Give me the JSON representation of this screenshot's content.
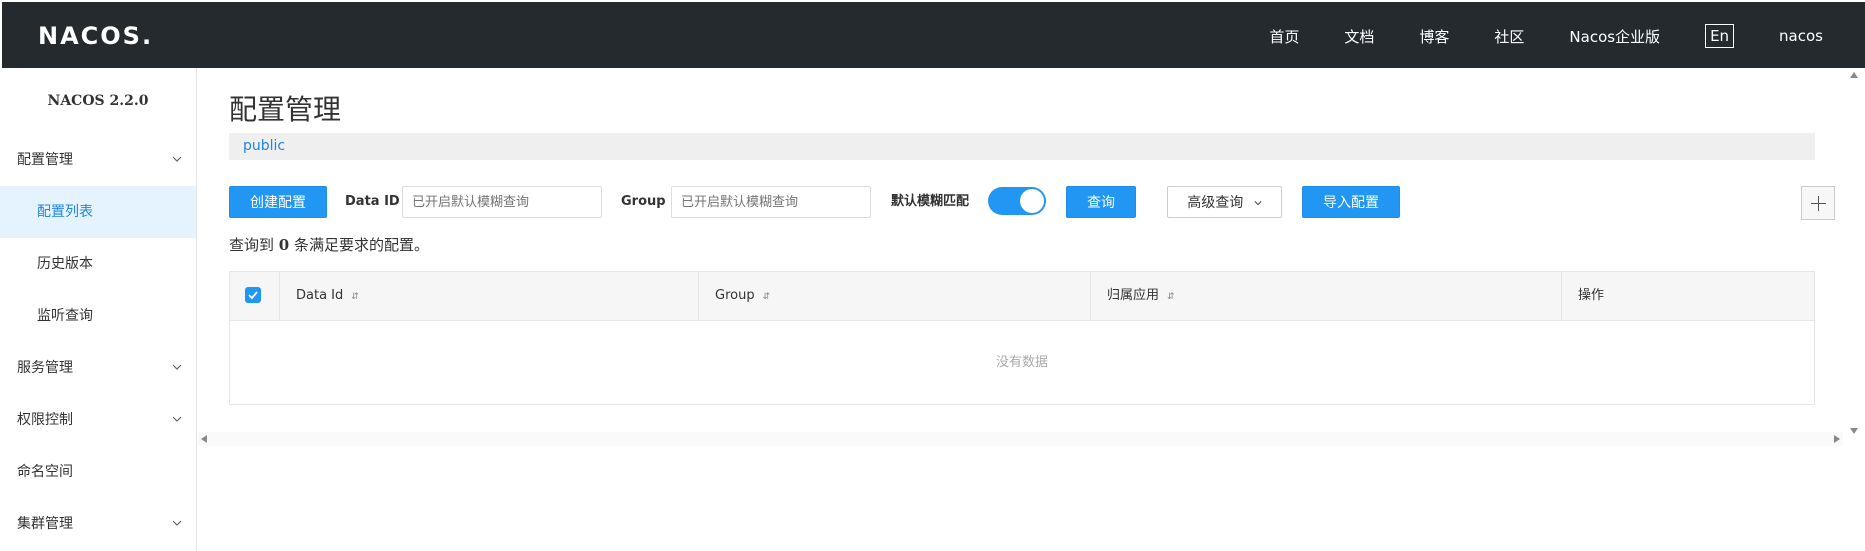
{
  "header": {
    "logo": "NACOS",
    "logo_dot": ".",
    "nav": [
      "首页",
      "文档",
      "博客",
      "社区",
      "Nacos企业版"
    ],
    "lang": "En",
    "user": "nacos"
  },
  "sidebar": {
    "version": "NACOS 2.2.0",
    "items": [
      {
        "label": "配置管理",
        "type": "group",
        "expanded": true
      },
      {
        "label": "配置列表",
        "type": "sub",
        "active": true
      },
      {
        "label": "历史版本",
        "type": "sub"
      },
      {
        "label": "监听查询",
        "type": "sub"
      },
      {
        "label": "服务管理",
        "type": "group"
      },
      {
        "label": "权限控制",
        "type": "group"
      },
      {
        "label": "命名空间",
        "type": "item"
      },
      {
        "label": "集群管理",
        "type": "group"
      }
    ]
  },
  "main": {
    "title": "配置管理",
    "namespace": "public",
    "toolbar": {
      "create_label": "创建配置",
      "data_id_label": "Data ID",
      "data_id_placeholder": "已开启默认模糊查询",
      "group_label": "Group",
      "group_placeholder": "已开启默认模糊查询",
      "fuzzy_label": "默认模糊匹配",
      "fuzzy_on": true,
      "query_label": "查询",
      "advanced_label": "高级查询",
      "import_label": "导入配置"
    },
    "result": {
      "prefix": "查询到",
      "count": "0",
      "suffix": "条满足要求的配置。"
    },
    "table": {
      "columns": [
        "Data Id",
        "Group",
        "归属应用",
        "操作"
      ],
      "empty_text": "没有数据"
    }
  },
  "colors": {
    "header_bg": "#252a2f",
    "primary": "#2196f3",
    "active_bg": "#e4f3fe",
    "link": "#2185e6"
  }
}
